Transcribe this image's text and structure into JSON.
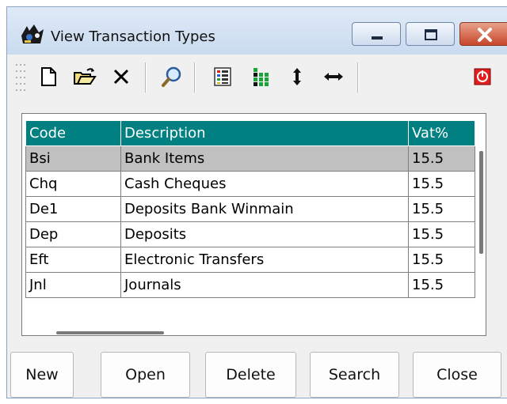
{
  "window": {
    "title": "View Transaction Types"
  },
  "toolbar": {
    "icons": [
      "new-file-icon",
      "open-folder-icon",
      "delete-icon",
      "search-icon",
      "view-list-icon",
      "sort-icon",
      "vertical-resize-icon",
      "horizontal-resize-icon",
      "exit-icon"
    ]
  },
  "grid": {
    "columns": [
      "Code",
      "Description",
      "Vat%"
    ],
    "rows": [
      {
        "code": "Bsi",
        "description": "Bank Items",
        "vat": "15.5"
      },
      {
        "code": "Chq",
        "description": "Cash Cheques",
        "vat": "15.5"
      },
      {
        "code": "De1",
        "description": "Deposits Bank Winmain",
        "vat": "15.5"
      },
      {
        "code": "Dep",
        "description": "Deposits",
        "vat": "15.5"
      },
      {
        "code": "Eft",
        "description": "Electronic Transfers",
        "vat": "15.5"
      },
      {
        "code": "Jnl",
        "description": "Journals",
        "vat": "15.5"
      }
    ],
    "selected_row": 0
  },
  "buttons": {
    "new": "New",
    "open": "Open",
    "delete": "Delete",
    "search": "Search",
    "close": "Close"
  },
  "colors": {
    "header_bg": "#008080",
    "selected_row_bg": "#c0c0c0"
  }
}
